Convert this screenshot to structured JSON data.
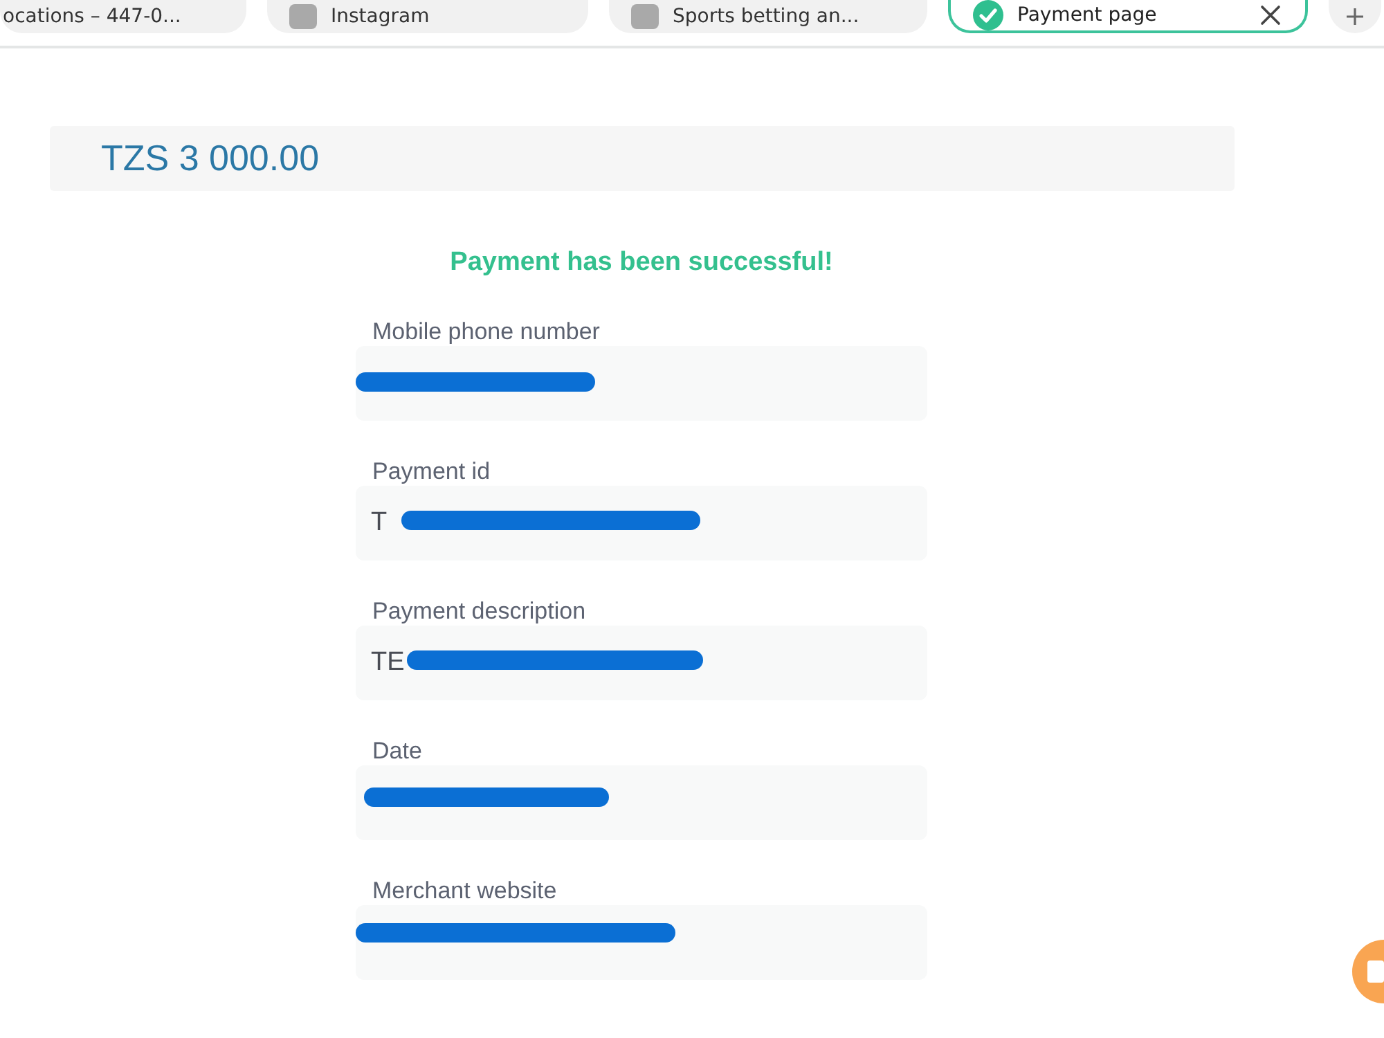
{
  "browser_tabs": [
    {
      "title": "ocations – 447-0...",
      "kind": "plain",
      "selected": false
    },
    {
      "title": "Instagram",
      "kind": "favicon",
      "selected": false
    },
    {
      "title": "Sports betting an...",
      "kind": "favicon",
      "selected": false
    },
    {
      "title": "Payment page",
      "kind": "check",
      "selected": true
    }
  ],
  "amount": "TZS 3 000.00",
  "status_message": "Payment has been successful!",
  "fields": [
    {
      "label": "Mobile phone number",
      "redacted": true
    },
    {
      "label": "Payment id",
      "value": "T",
      "redacted": true
    },
    {
      "label": "Payment description",
      "value": "TE",
      "redacted": true
    },
    {
      "label": "Date",
      "redacted": true
    },
    {
      "label": "Merchant website",
      "redacted": true
    }
  ]
}
